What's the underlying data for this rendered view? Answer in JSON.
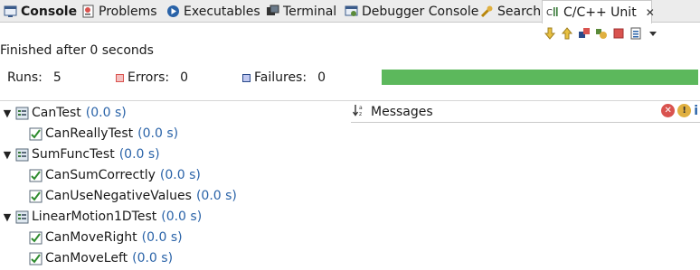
{
  "tabs": [
    {
      "label": "Console",
      "icon": "console-icon",
      "active": false,
      "bold": true
    },
    {
      "label": "Problems",
      "icon": "problems-icon",
      "active": false
    },
    {
      "label": "Executables",
      "icon": "executables-icon",
      "active": false
    },
    {
      "label": "Terminal",
      "icon": "terminal-icon",
      "active": false
    },
    {
      "label": "Debugger Console",
      "icon": "debugger-console-icon",
      "active": false
    },
    {
      "label": "Search",
      "icon": "search-icon",
      "active": false
    },
    {
      "label": "C/C++ Unit",
      "icon": "cpp-unit-icon",
      "active": true,
      "close": "✕"
    }
  ],
  "toolbar_icons": [
    "next-failure-icon",
    "previous-failure-icon",
    "show-failures-only-icon",
    "rerun-icon",
    "stop-icon",
    "history-icon",
    "view-menu-icon"
  ],
  "status": "Finished after 0 seconds",
  "counters": {
    "runs_label": "Runs:",
    "runs_value": "5",
    "errors_label": "Errors:",
    "errors_value": "0",
    "failures_label": "Failures:",
    "failures_value": "0"
  },
  "progress": {
    "fraction": 1.0,
    "color": "#5cb85c"
  },
  "tree": [
    {
      "label": "CanTest",
      "time": "(0.0 s)",
      "type": "suite"
    },
    {
      "label": "CanReallyTest",
      "time": "(0.0 s)",
      "type": "case"
    },
    {
      "label": "SumFuncTest",
      "time": "(0.0 s)",
      "type": "suite"
    },
    {
      "label": "CanSumCorrectly",
      "time": "(0.0 s)",
      "type": "case"
    },
    {
      "label": "CanUseNegativeValues",
      "time": "(0.0 s)",
      "type": "case"
    },
    {
      "label": "LinearMotion1DTest",
      "time": "(0.0 s)",
      "type": "suite"
    },
    {
      "label": "CanMoveRight",
      "time": "(0.0 s)",
      "type": "case"
    },
    {
      "label": "CanMoveLeft",
      "time": "(0.0 s)",
      "type": "case"
    }
  ],
  "messages": {
    "title": "Messages",
    "sort_glyph": "↓a z",
    "info_glyph": "i"
  },
  "colors": {
    "accent": "#2a63a8",
    "success": "#5cb85c",
    "error": "#d9534f",
    "warning": "#f0ad4e"
  }
}
